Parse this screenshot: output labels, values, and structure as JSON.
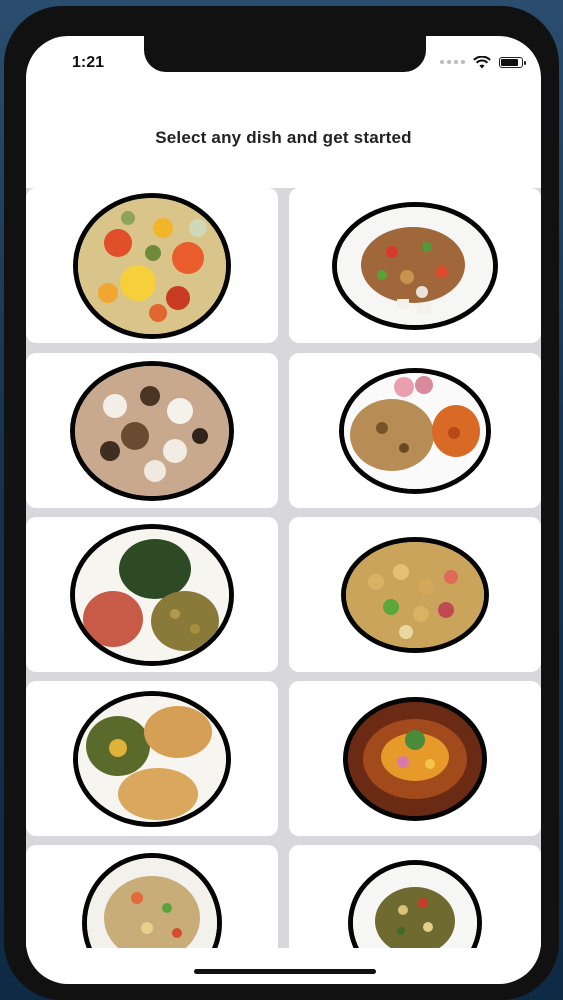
{
  "status_bar": {
    "time": "1:21"
  },
  "header": {
    "title": "Select any dish and get started"
  },
  "dishes": [
    {
      "icon": "biryani-plate-icon"
    },
    {
      "icon": "bhel-plate-icon"
    },
    {
      "icon": "dahi-papdi-plate-icon"
    },
    {
      "icon": "paratha-curry-plate-icon"
    },
    {
      "icon": "saag-chana-plate-icon"
    },
    {
      "icon": "chana-chaat-plate-icon"
    },
    {
      "icon": "saag-puri-plate-icon"
    },
    {
      "icon": "misal-pav-plate-icon"
    },
    {
      "icon": "poha-plate-icon"
    },
    {
      "icon": "sprouts-plate-icon"
    }
  ]
}
